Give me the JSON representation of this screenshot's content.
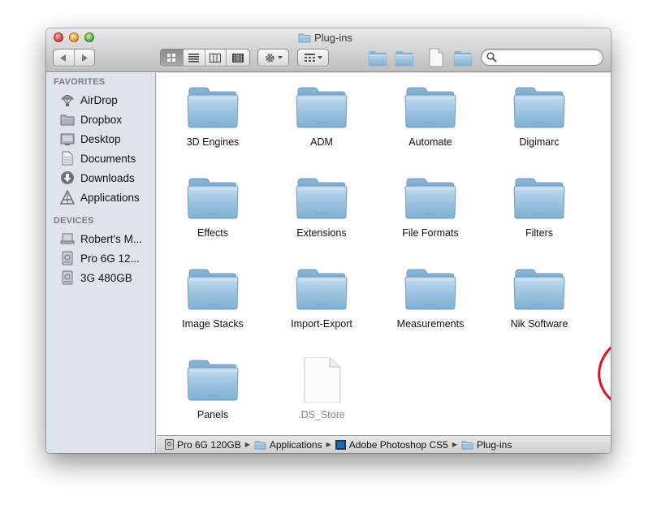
{
  "window": {
    "title": "Plug-ins"
  },
  "toolbar": {
    "back_icon": "back-arrow-icon",
    "forward_icon": "forward-arrow-icon",
    "view_modes": [
      "icon-view",
      "list-view",
      "column-view",
      "coverflow-view"
    ],
    "active_view": "icon-view",
    "action_icon": "gear-icon",
    "arrange_icon": "arrange-grid-icon",
    "search": {
      "value": "",
      "placeholder": ""
    }
  },
  "sidebar": {
    "favorites_header": "FAVORITES",
    "favorites": [
      {
        "label": "AirDrop",
        "icon": "airdrop-icon"
      },
      {
        "label": "Dropbox",
        "icon": "folder-icon"
      },
      {
        "label": "Desktop",
        "icon": "desktop-icon"
      },
      {
        "label": "Documents",
        "icon": "documents-icon"
      },
      {
        "label": "Downloads",
        "icon": "downloads-icon"
      },
      {
        "label": "Applications",
        "icon": "applications-icon"
      }
    ],
    "devices_header": "DEVICES",
    "devices": [
      {
        "label": "Robert's M...",
        "icon": "laptop-icon"
      },
      {
        "label": "Pro 6G 12...",
        "icon": "disk-icon"
      },
      {
        "label": "3G 480GB",
        "icon": "disk-icon"
      }
    ]
  },
  "content": {
    "items": [
      {
        "label": "3D Engines",
        "type": "folder"
      },
      {
        "label": "ADM",
        "type": "folder"
      },
      {
        "label": "Automate",
        "type": "folder"
      },
      {
        "label": "Digimarc",
        "type": "folder"
      },
      {
        "label": "Effects",
        "type": "folder"
      },
      {
        "label": "Extensions",
        "type": "folder"
      },
      {
        "label": "File Formats",
        "type": "folder"
      },
      {
        "label": "Filters",
        "type": "folder"
      },
      {
        "label": "Image Stacks",
        "type": "folder"
      },
      {
        "label": "Import-Export",
        "type": "folder"
      },
      {
        "label": "Measurements",
        "type": "folder"
      },
      {
        "label": "Nik Software",
        "type": "folder"
      },
      {
        "label": "Panels",
        "type": "folder"
      },
      {
        "label": ".DS_Store",
        "type": "file"
      }
    ],
    "highlighted": "Nik Software",
    "highlight_color": "#e3101b"
  },
  "pathbar": {
    "crumbs": [
      {
        "label": "Pro 6G 120GB",
        "icon": "disk-icon"
      },
      {
        "label": "Applications",
        "icon": "applications-folder-icon"
      },
      {
        "label": "Adobe Photoshop CS5",
        "icon": "photoshop-icon"
      },
      {
        "label": "Plug-ins",
        "icon": "folder-icon"
      }
    ]
  },
  "colors": {
    "folder_blue": "#8fbad8",
    "sidebar_bg": "#dee4ea",
    "sidebar_header": "#707e8b"
  }
}
